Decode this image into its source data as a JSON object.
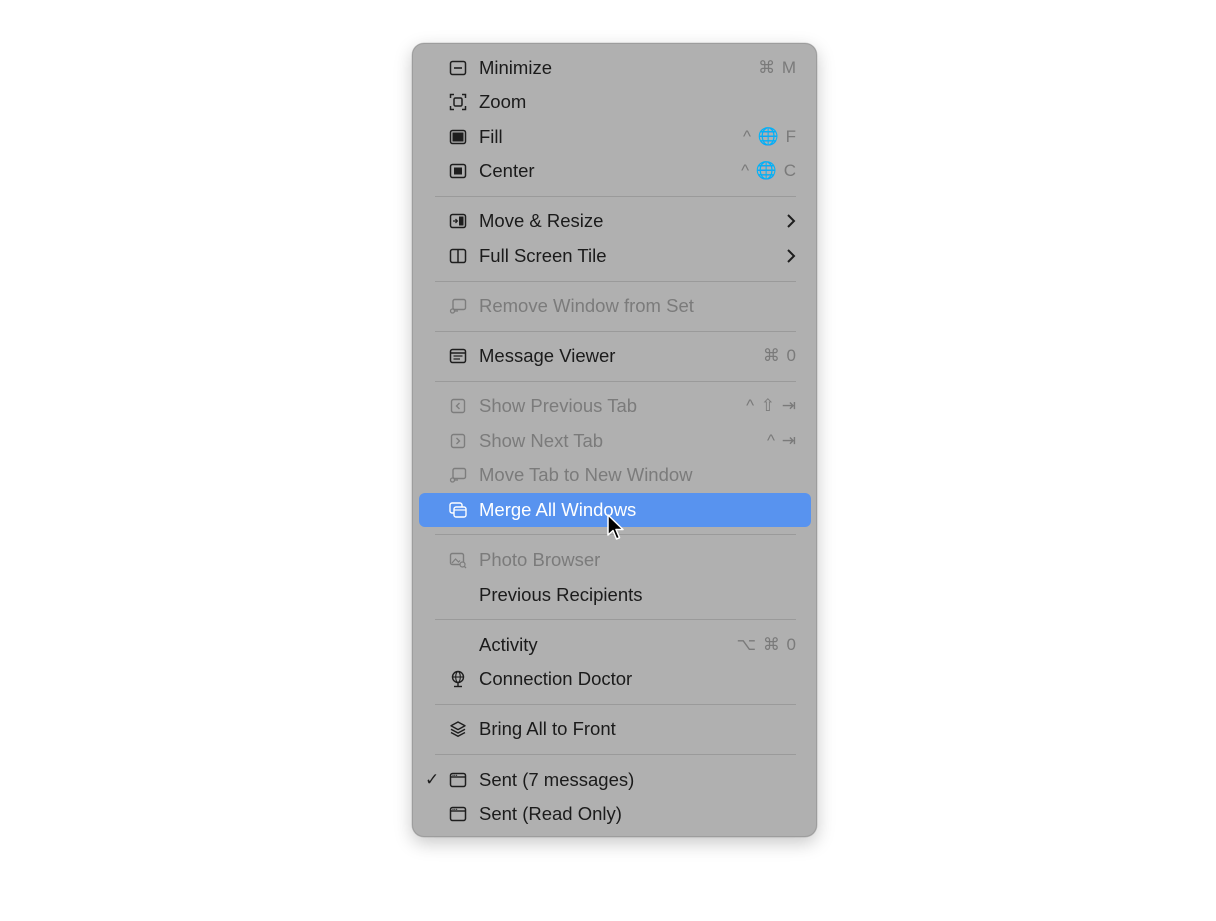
{
  "menu": {
    "items": [
      {
        "label": "Minimize",
        "shortcut": "⌘ M",
        "icon": "minimize-icon",
        "enabled": true
      },
      {
        "label": "Zoom",
        "shortcut": "",
        "icon": "zoom-icon",
        "enabled": true
      },
      {
        "label": "Fill",
        "shortcut": "^ 🌐 F",
        "icon": "fill-icon",
        "enabled": true
      },
      {
        "label": "Center",
        "shortcut": "^ 🌐 C",
        "icon": "center-icon",
        "enabled": true
      },
      {
        "label": "Move & Resize",
        "shortcut": "",
        "icon": "move-resize-icon",
        "enabled": true,
        "submenu": true
      },
      {
        "label": "Full Screen Tile",
        "shortcut": "",
        "icon": "full-screen-tile-icon",
        "enabled": true,
        "submenu": true
      },
      {
        "label": "Remove Window from Set",
        "shortcut": "",
        "icon": "remove-window-icon",
        "enabled": false
      },
      {
        "label": "Message Viewer",
        "shortcut": "⌘ 0",
        "icon": "message-viewer-icon",
        "enabled": true
      },
      {
        "label": "Show Previous Tab",
        "shortcut": "^ ⇧ ⇥",
        "icon": "previous-tab-icon",
        "enabled": false
      },
      {
        "label": "Show Next Tab",
        "shortcut": "^ ⇥",
        "icon": "next-tab-icon",
        "enabled": false
      },
      {
        "label": "Move Tab to New Window",
        "shortcut": "",
        "icon": "move-tab-icon",
        "enabled": false
      },
      {
        "label": "Merge All Windows",
        "shortcut": "",
        "icon": "merge-windows-icon",
        "enabled": true,
        "highlighted": true
      },
      {
        "label": "Photo Browser",
        "shortcut": "",
        "icon": "photo-browser-icon",
        "enabled": false
      },
      {
        "label": "Previous Recipients",
        "shortcut": "",
        "icon": "",
        "enabled": true
      },
      {
        "label": "Activity",
        "shortcut": "⌥ ⌘ 0",
        "icon": "",
        "enabled": true
      },
      {
        "label": "Connection Doctor",
        "shortcut": "",
        "icon": "connection-doctor-icon",
        "enabled": true
      },
      {
        "label": "Bring All to Front",
        "shortcut": "",
        "icon": "bring-to-front-icon",
        "enabled": true
      },
      {
        "label": "Sent (7 messages)",
        "shortcut": "",
        "icon": "window-icon",
        "enabled": true,
        "checked": true
      },
      {
        "label": "Sent (Read Only)",
        "shortcut": "",
        "icon": "window-icon",
        "enabled": true
      }
    ],
    "checkmark": "✓",
    "colors": {
      "menu_background": "#b0b0b0",
      "highlight": "#5893ef",
      "text": "#1b1b1b",
      "disabled_text": "#7b7b7b",
      "shortcut_text": "#7a7a7a"
    }
  }
}
